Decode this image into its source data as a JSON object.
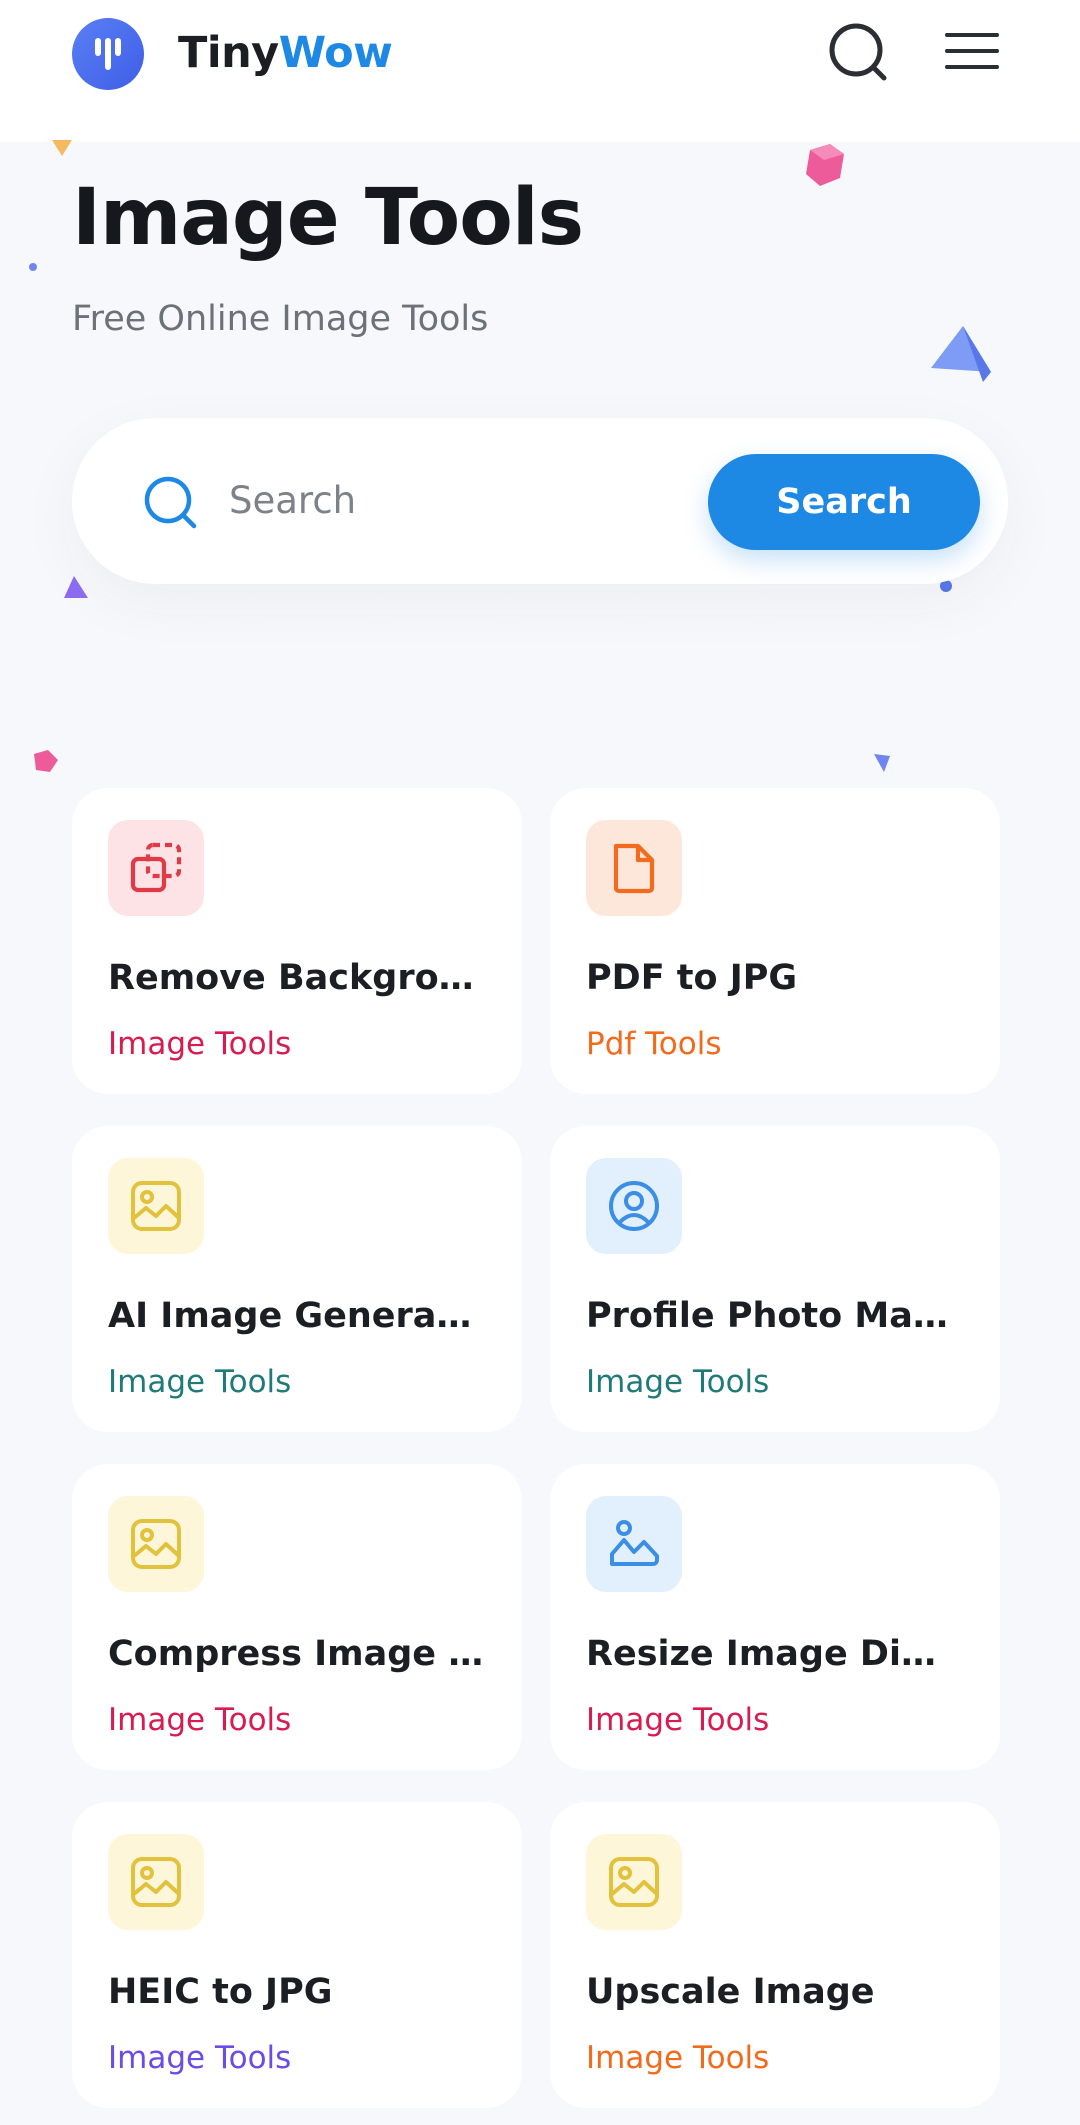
{
  "header": {
    "brand_part1": "Tiny",
    "brand_part2": "Wow",
    "logo_icon": "tinywow-logo",
    "search_icon": "search-icon",
    "menu_icon": "hamburger-menu-icon"
  },
  "hero": {
    "title": "Image Tools",
    "subtitle": "Free Online Image Tools"
  },
  "search": {
    "placeholder": "Search",
    "value": "",
    "button_label": "Search"
  },
  "colors": {
    "accent": "#1e88e5",
    "brand_blue": "#4a6cf0",
    "category_red": "#d81b50",
    "category_orange": "#f26b1d",
    "category_teal": "#1f7a78",
    "category_purple": "#6a4de6"
  },
  "tools": [
    {
      "title": "Remove Background",
      "category": "Image Tools",
      "icon": "remove-background-icon",
      "category_color": "#d81b50"
    },
    {
      "title": "PDF to JPG",
      "category": "Pdf Tools",
      "icon": "document-icon",
      "category_color": "#f26b1d"
    },
    {
      "title": "AI Image Generator",
      "category": "Image Tools",
      "icon": "image-icon",
      "category_color": "#1f7a78"
    },
    {
      "title": "Profile Photo Maker",
      "category": "Image Tools",
      "icon": "profile-icon",
      "category_color": "#1f7a78"
    },
    {
      "title": "Compress Image Size",
      "category": "Image Tools",
      "icon": "image-icon",
      "category_color": "#d81b50"
    },
    {
      "title": "Resize Image Dimensions",
      "category": "Image Tools",
      "icon": "landscape-icon",
      "category_color": "#d81b50"
    },
    {
      "title": "HEIC to JPG",
      "category": "Image Tools",
      "icon": "image-icon",
      "category_color": "#6a4de6"
    },
    {
      "title": "Upscale Image",
      "category": "Image Tools",
      "icon": "image-icon",
      "category_color": "#f26b1d"
    }
  ]
}
